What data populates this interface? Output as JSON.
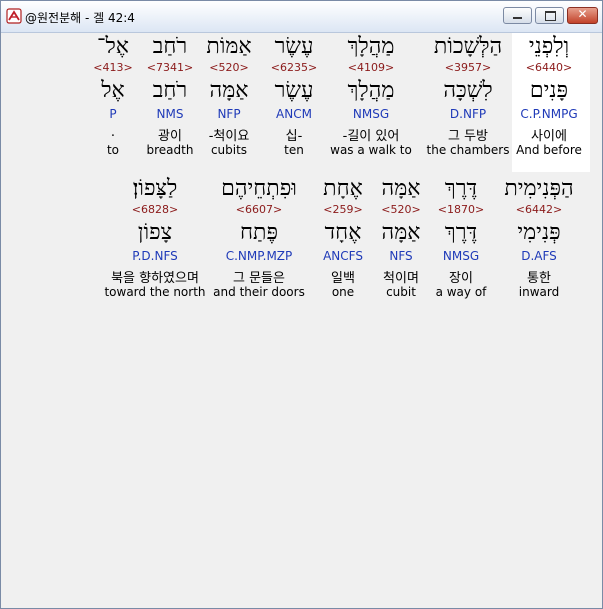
{
  "window": {
    "title": "@원전분해 - 겔 42:4",
    "icon": "app-logo-icon",
    "buttons": {
      "minimize": "minimize-icon",
      "maximize": "maximize-icon",
      "close": "✕"
    }
  },
  "rows": [
    {
      "words": [
        {
          "hebrew": "וְלִפְנֵי",
          "strong": "<6440>",
          "lemma": "פָּנִים",
          "parse": "C.P.NMPG",
          "korean": "사이에",
          "english": "And before",
          "selected": true
        },
        {
          "hebrew": "הַלְּשָׁכוֹת",
          "strong": "<3957>",
          "lemma": "לִשְׁכָּה",
          "parse": "D.NFP",
          "korean": "그 두방",
          "english": "the chambers"
        },
        {
          "hebrew": "מַהֲלָךְ",
          "strong": "<4109>",
          "lemma": "מַהֲלָךְ",
          "parse": "NMSG",
          "korean": "-길이 있어",
          "english": "was a walk to"
        },
        {
          "hebrew": "עֶשֶׂר",
          "strong": "<6235>",
          "lemma": "עֶשֶׂר",
          "parse": "ANCM",
          "korean": "십-",
          "english": "ten"
        },
        {
          "hebrew": "אַמּוֹת",
          "strong": "<520>",
          "lemma": "אַמָּה",
          "parse": "NFP",
          "korean": "-척이요",
          "english": "cubits"
        },
        {
          "hebrew": "רֹחַב",
          "strong": "<7341>",
          "lemma": "רֹחַב",
          "parse": "NMS",
          "korean": "광이",
          "english": "breadth"
        },
        {
          "hebrew": "אֶל־",
          "strong": "<413>",
          "lemma": "אֶל",
          "parse": "P",
          "korean": ".",
          "english": "to"
        }
      ]
    },
    {
      "words": [
        {
          "hebrew": "הַפְּנִימִית",
          "strong": "<6442>",
          "lemma": "פְּנִימִי",
          "parse": "D.AFS",
          "korean": "통한",
          "english": "inward"
        },
        {
          "hebrew": "דֶּרֶךְ",
          "strong": "<1870>",
          "lemma": "דֶּרֶךְ",
          "parse": "NMSG",
          "korean": "장이",
          "english": "a way of"
        },
        {
          "hebrew": "אַמָּה",
          "strong": "<520>",
          "lemma": "אַמָּה",
          "parse": "NFS",
          "korean": "척이며",
          "english": "cubit"
        },
        {
          "hebrew": "אֶחָת",
          "strong": "<259>",
          "lemma": "אֶחָד",
          "parse": "ANCFS",
          "korean": "일백",
          "english": "one"
        },
        {
          "hebrew": "וּפִתְחֵיהֶם",
          "strong": "<6607>",
          "lemma": "פֶּתַח",
          "parse": "C.NMP.MZP",
          "korean": "그 문들은",
          "english": "and their doors"
        },
        {
          "hebrew": "לַצָּפוֹן׃",
          "strong": "<6828>",
          "lemma": "צָפוֹן",
          "parse": "P.D.NFS",
          "korean": "북을 향하였으며",
          "english": "toward the north"
        }
      ]
    }
  ]
}
